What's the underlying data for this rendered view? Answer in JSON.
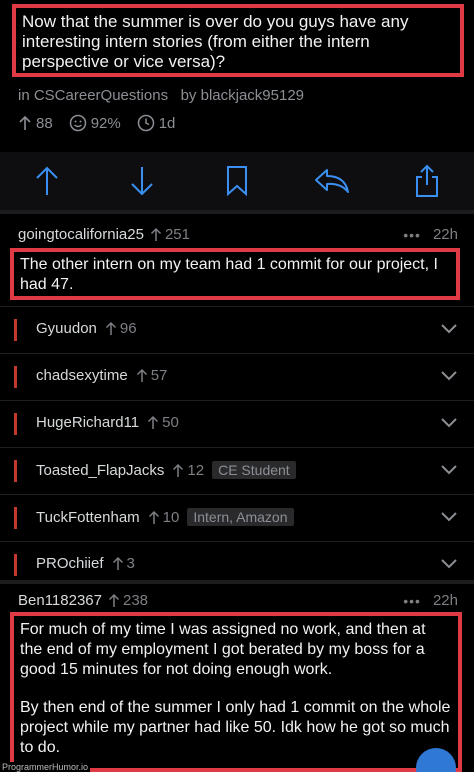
{
  "post": {
    "title": "Now that the summer is over do you guys have any interesting intern stories (from either the intern perspective or vice versa)?",
    "subreddit_line": "in CSCareerQuestions",
    "author_line": "by blackjack95129",
    "score": "88",
    "upvote_ratio": "92%",
    "age": "1d"
  },
  "actions": [
    "upvote-icon",
    "downvote-icon",
    "bookmark-icon",
    "reply-icon",
    "share-icon"
  ],
  "comment1": {
    "author": "goingtocalifornia25",
    "score": "251",
    "dots": "•••",
    "age": "22h",
    "body": "The other intern on my team had 1 commit for our project, I had 47."
  },
  "replies": [
    {
      "author": "Gyuudon",
      "score": "96",
      "flair": ""
    },
    {
      "author": "chadsexytime",
      "score": "57",
      "flair": ""
    },
    {
      "author": "HugeRichard11",
      "score": "50",
      "flair": ""
    },
    {
      "author": "Toasted_FlapJacks",
      "score": "12",
      "flair": "CE Student"
    },
    {
      "author": "TuckFottenham",
      "score": "10",
      "flair": "Intern, Amazon"
    },
    {
      "author": "PROchiief",
      "score": "3",
      "flair": ""
    }
  ],
  "comment2": {
    "author": "Ben1182367",
    "score": "238",
    "dots": "•••",
    "age": "22h",
    "body_p1": "For much of my time I was assigned no work, and then at the end of my employment I got berated by my boss for a good 15 minutes for not doing enough work.",
    "body_p2": "By then end of the summer I only had 1 commit on the whole project while my partner had like 50. Idk how he got so much to do."
  },
  "watermark": "ProgrammerHumor.io",
  "colors": {
    "highlight": "#e03a45",
    "icon_blue": "#3b8ff0",
    "thread_bar": "#c0392b"
  }
}
